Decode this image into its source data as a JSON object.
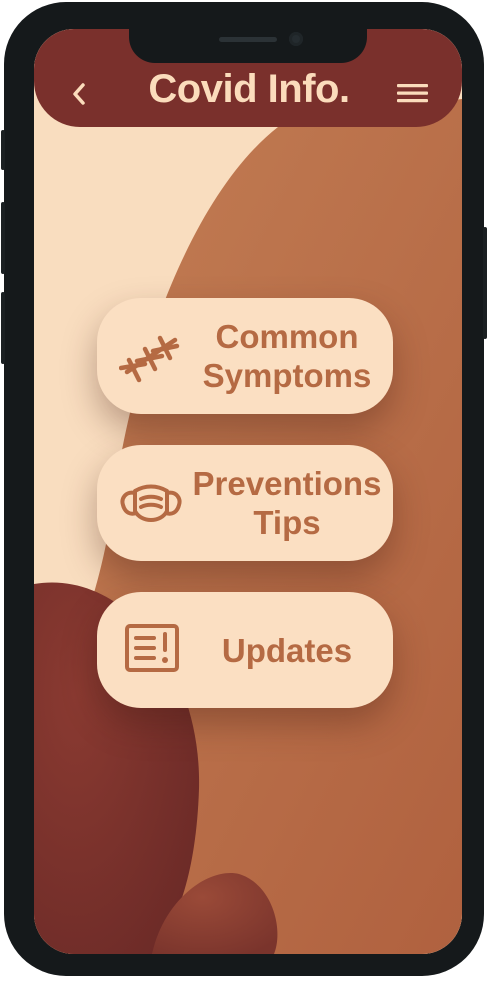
{
  "app": {
    "title": "Covid Info."
  },
  "header": {
    "back_icon": "chevron-left-icon",
    "menu_icon": "hamburger-menu-icon"
  },
  "menu": {
    "items": [
      {
        "label": "Common\nSymptoms",
        "icon": "virus-stitches-icon"
      },
      {
        "label": "Preventions\nTips",
        "icon": "face-mask-icon"
      },
      {
        "label": "Updates",
        "icon": "news-alert-icon"
      }
    ]
  },
  "colors": {
    "header": "#7a302c",
    "accent_text": "#b56a43",
    "card_bg": "#fbdfc2",
    "background_light": "#f9ddbf",
    "background_mid": "#b86b47",
    "background_dark": "#7a302c",
    "frame": "#15191b"
  }
}
